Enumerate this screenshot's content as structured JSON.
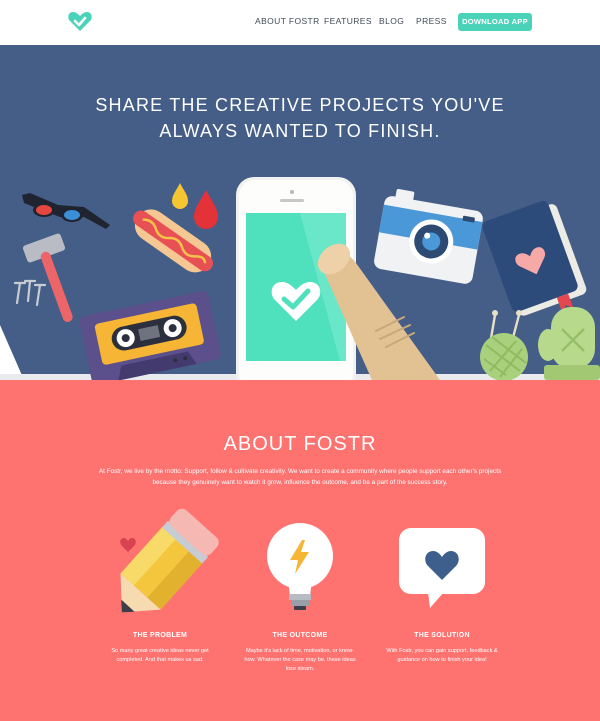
{
  "nav": {
    "links": [
      "ABOUT FOSTR",
      "FEATURES",
      "BLOG",
      "PRESS"
    ],
    "download_label": "DOWNLOAD APP",
    "logo_icon": "heart-check-icon",
    "accent": "#4ad3b8"
  },
  "hero": {
    "title_line1": "SHARE THE CREATIVE PROJECTS YOU'VE",
    "title_line2": "ALWAYS WANTED TO FINISH.",
    "background": "#455e87"
  },
  "about": {
    "title": "ABOUT FOSTR",
    "text": "At Fostr, we live by the motto: Support, follow & cultivate creativity. We want to create a community where people support each other's projects because they genuinely want to watch it grow, influence the outcome, and be a part of the success story.",
    "background": "#fe7270",
    "features": [
      {
        "title": "THE PROBLEM",
        "text": "So many great creative ideas never get completed. And that makes us sad.",
        "icon": "pencil-icon"
      },
      {
        "title": "THE OUTCOME",
        "text": "Maybe it's lack of time, motivation, or know-how. Whatever the case may be, these ideas lose steam.",
        "icon": "lightbulb-icon"
      },
      {
        "title": "THE SOLUTION",
        "text": "With Fostr, you can gain support, feedback & guidance on how to finish your idea!",
        "icon": "heart-speech-bubble-icon"
      }
    ]
  }
}
